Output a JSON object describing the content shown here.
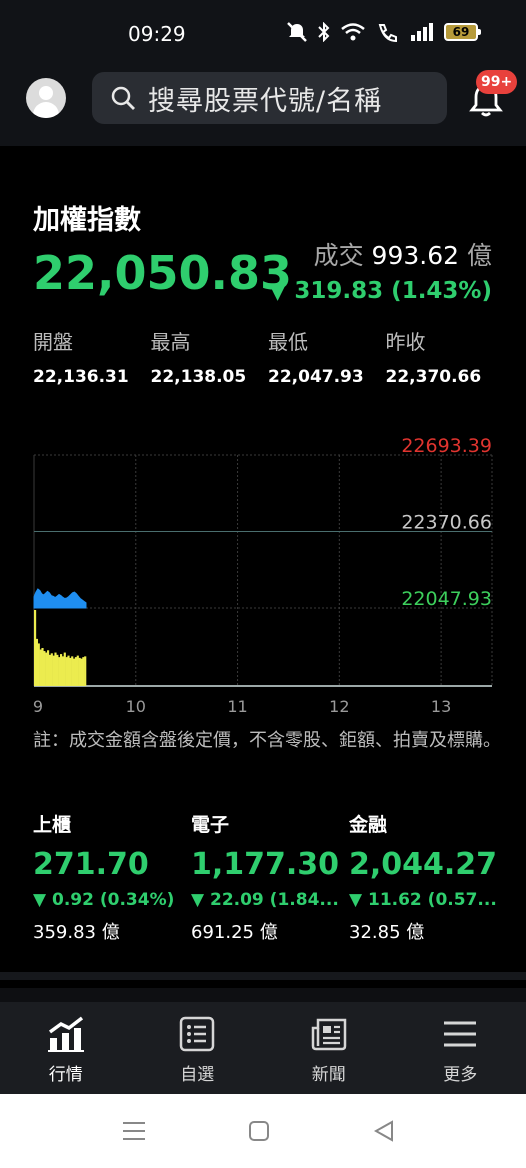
{
  "status_bar": {
    "time": "09:29",
    "battery": "69"
  },
  "header": {
    "search_placeholder": "搜尋股票代號/名稱",
    "notification_badge": "99+"
  },
  "index": {
    "name": "加權指數",
    "value": "22,050.83",
    "volume_label": "成交",
    "volume_value": "993.62",
    "volume_unit": "億",
    "change": "▼ 319.83 (1.43%)",
    "direction": "down",
    "ohlc": [
      {
        "label": "開盤",
        "value": "22,136.31"
      },
      {
        "label": "最高",
        "value": "22,138.05"
      },
      {
        "label": "最低",
        "value": "22,047.93"
      },
      {
        "label": "昨收",
        "value": "22,370.66"
      }
    ]
  },
  "chart_data": {
    "type": "area",
    "y_labels": {
      "upper": "22693.39",
      "reference": "22370.66",
      "lower": "22047.93"
    },
    "ylim": [
      22047.93,
      22693.39
    ],
    "x_ticks": [
      "9",
      "10",
      "11",
      "12",
      "13"
    ],
    "series": [
      {
        "values": [
          22095,
          22115,
          22128,
          22122,
          22108,
          22103,
          22110,
          22118,
          22112,
          22100,
          22097,
          22092,
          22098,
          22105,
          22100,
          22093,
          22088,
          22090,
          22096,
          22104,
          22112,
          22115,
          22108,
          22098,
          22088,
          22082,
          22076,
          22070
        ]
      }
    ],
    "volume_bars": [
      100,
      62,
      56,
      48,
      50,
      46,
      44,
      47,
      41,
      43,
      40,
      44,
      41,
      38,
      42,
      39,
      44,
      38,
      40,
      37,
      39,
      36,
      38,
      40,
      37,
      36,
      38,
      39
    ],
    "grid": true,
    "colors": {
      "line": "#1f8ef0",
      "volume": "#ecec4f",
      "upper": "#e0342f",
      "reference": "#c8c8c8",
      "lower": "#3dcf5c"
    }
  },
  "note": "註：成交金額含盤後定價，不含零股、鉅額、拍賣及標購。",
  "sub_indexes": [
    {
      "name": "上櫃",
      "value": "271.70",
      "change": "▼ 0.92 (0.34%)",
      "volume": "359.83 億"
    },
    {
      "name": "電子",
      "value": "1,177.30",
      "change": "▼ 22.09 (1.84...",
      "volume": "691.25 億"
    },
    {
      "name": "金融",
      "value": "2,044.27",
      "change": "▼ 11.62 (0.57...",
      "volume": "32.85 億"
    }
  ],
  "bottom_nav": [
    {
      "label": "行情",
      "icon": "chart-icon",
      "active": true
    },
    {
      "label": "自選",
      "icon": "list-icon",
      "active": false
    },
    {
      "label": "新聞",
      "icon": "newspaper-icon",
      "active": false
    },
    {
      "label": "更多",
      "icon": "menu-icon",
      "active": false
    }
  ],
  "colors": {
    "down": "#2fce6e",
    "badge": "#e8413c",
    "background": "#000000"
  }
}
